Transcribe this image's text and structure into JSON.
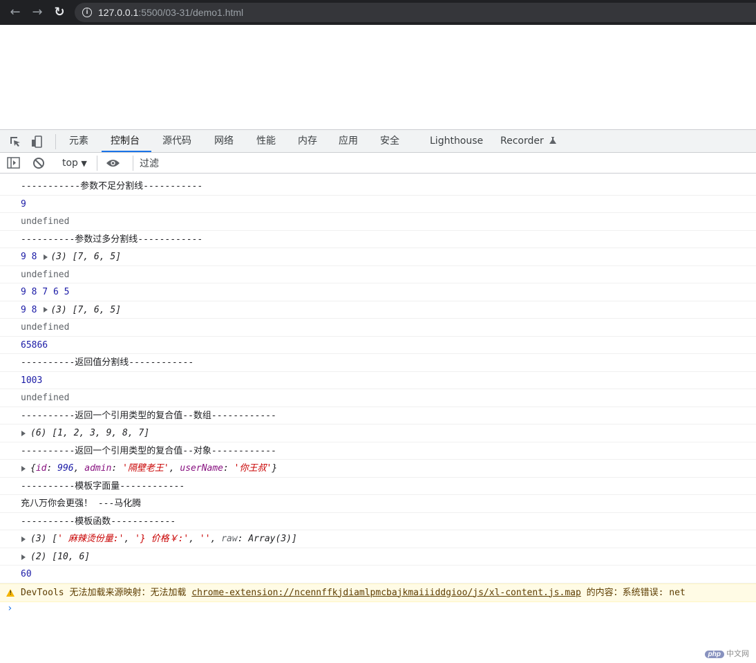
{
  "browser": {
    "url_host": "127.0.0.1",
    "url_path": ":5500/03-31/demo1.html"
  },
  "devtools": {
    "tabs": [
      "元素",
      "控制台",
      "源代码",
      "网络",
      "性能",
      "内存",
      "应用",
      "安全",
      "Lighthouse",
      "Recorder"
    ],
    "active_tab": "控制台",
    "context": "top",
    "filter_placeholder": "过滤"
  },
  "console": {
    "rows": {
      "r1": "-----------参数不足分割线-----------",
      "r2": "9",
      "r3": "undefined",
      "r4": "----------参数过多分割线------------",
      "r5_prefix": "9 8",
      "r5_obj": "(3) [7, 6, 5]",
      "r6": "undefined",
      "r7": "9 8 7 6 5",
      "r8_prefix": "9 8",
      "r8_obj": "(3) [7, 6, 5]",
      "r9": "undefined",
      "r10": "65866",
      "r11": "----------返回值分割线------------",
      "r12": "1003",
      "r13": "undefined",
      "r14": "----------返回一个引用类型的复合值--数组------------",
      "r15": "(6) [1, 2, 3, 9, 8, 7]",
      "r16": "----------返回一个引用类型的复合值--对象------------",
      "r17_parts": {
        "open": "{",
        "id_key": "id",
        "id_val": "996",
        "admin_key": "admin",
        "admin_val": "'隔壁老王'",
        "user_key": "userName",
        "user_val": "'你王叔'",
        "close": "}"
      },
      "r18": "----------模板字面量------------",
      "r19": "充八万你会更强！ ---马化腾",
      "r20": "----------模板函数------------",
      "r21_parts": {
        "head": "(3) [",
        "s1": "' 麻辣烫份量:'",
        "s2": "'} 价格￥:'",
        "s3": "''",
        "raw_key": "raw",
        "raw_val": "Array(3)",
        "tail": "]"
      },
      "r22": "(2) [10, 6]",
      "r23": "60"
    },
    "warning": {
      "before": "DevTools 无法加载来源映射：无法加载",
      "link": "chrome-extension://ncennffkjdiamlpmcbajkmaiiiddgioo/js/xl-content.js.map",
      "after": "的内容：系统错误: net"
    },
    "prompt": "›"
  },
  "watermark": {
    "badge": "php",
    "site": "中文网"
  },
  "colors": {
    "number": "#1a1aa6",
    "string": "#c80000",
    "accent": "#1a73e8",
    "warning_bg": "#fffbe5"
  }
}
